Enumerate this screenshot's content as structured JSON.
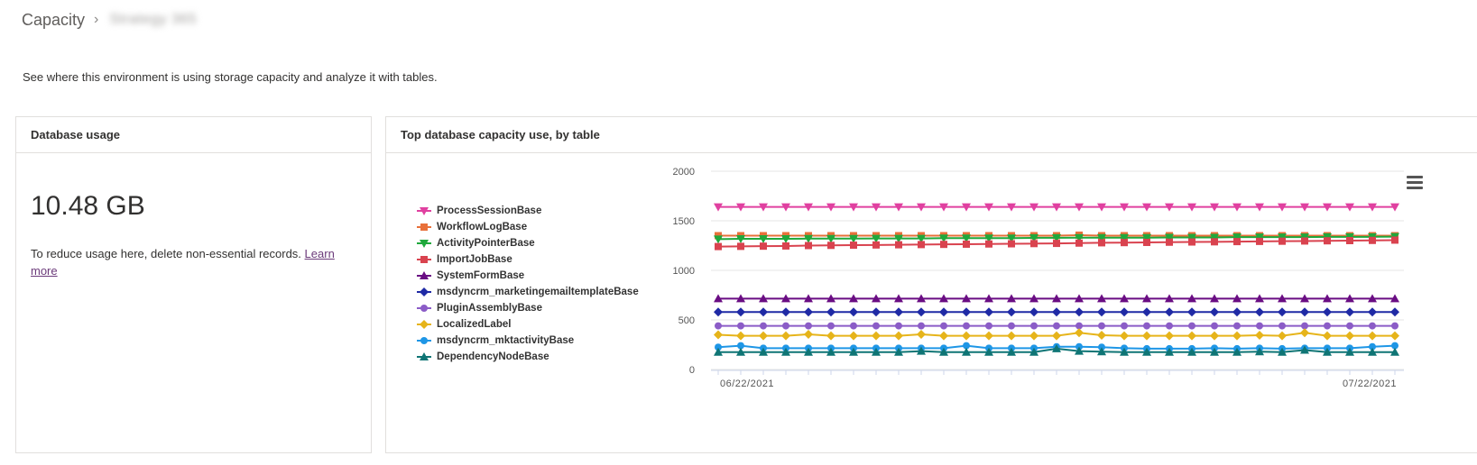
{
  "breadcrumb": {
    "root": "Capacity",
    "current": "Strategy 365"
  },
  "description": "See where this environment is using storage capacity and analyze it with tables.",
  "db_card": {
    "title": "Database usage",
    "value": "10.48 GB",
    "hint": "To reduce usage here, delete non-essential records.",
    "link": "Learn more"
  },
  "chart_card": {
    "title": "Top database capacity use, by table"
  },
  "chart_data": {
    "type": "line",
    "ylim": [
      0,
      2000
    ],
    "yticks": [
      0,
      500,
      1000,
      1500,
      2000
    ],
    "x_start_label": "06/22/2021",
    "x_end_label": "07/22/2021",
    "grid": true,
    "legend_placement": "left",
    "series": [
      {
        "name": "ProcessSessionBase",
        "color": "#e040a0",
        "marker": "triangle-down",
        "values": [
          1640,
          1640,
          1640,
          1640,
          1640,
          1640,
          1640,
          1640,
          1640,
          1640,
          1640,
          1640,
          1640,
          1640,
          1640,
          1640,
          1640,
          1640,
          1640,
          1640,
          1640,
          1640,
          1640,
          1640,
          1640,
          1640,
          1640,
          1640,
          1640,
          1640,
          1640
        ]
      },
      {
        "name": "WorkflowLogBase",
        "color": "#e8703a",
        "marker": "square",
        "values": [
          1350,
          1350,
          1350,
          1350,
          1350,
          1350,
          1350,
          1350,
          1350,
          1350,
          1350,
          1350,
          1350,
          1350,
          1350,
          1350,
          1355,
          1350,
          1350,
          1350,
          1350,
          1350,
          1350,
          1350,
          1350,
          1350,
          1350,
          1350,
          1350,
          1350,
          1350
        ]
      },
      {
        "name": "ActivityPointerBase",
        "color": "#1fa83c",
        "marker": "triangle-down",
        "values": [
          1315,
          1318,
          1318,
          1318,
          1320,
          1320,
          1320,
          1322,
          1322,
          1322,
          1325,
          1325,
          1325,
          1325,
          1328,
          1328,
          1330,
          1330,
          1330,
          1330,
          1332,
          1332,
          1332,
          1335,
          1335,
          1335,
          1335,
          1338,
          1338,
          1338,
          1340
        ]
      },
      {
        "name": "ImportJobBase",
        "color": "#d9434f",
        "marker": "square",
        "values": [
          1240,
          1242,
          1244,
          1246,
          1250,
          1252,
          1254,
          1256,
          1258,
          1260,
          1262,
          1264,
          1266,
          1268,
          1270,
          1272,
          1275,
          1278,
          1280,
          1282,
          1284,
          1286,
          1288,
          1290,
          1292,
          1294,
          1296,
          1298,
          1300,
          1302,
          1305
        ]
      },
      {
        "name": "SystemFormBase",
        "color": "#6a0d83",
        "marker": "triangle-up",
        "values": [
          715,
          715,
          715,
          715,
          715,
          715,
          715,
          715,
          715,
          715,
          715,
          715,
          715,
          715,
          715,
          715,
          715,
          715,
          715,
          715,
          715,
          715,
          715,
          715,
          715,
          715,
          715,
          715,
          715,
          715,
          715
        ]
      },
      {
        "name": "msdyncrm_marketingemailtemplateBase",
        "color": "#1f2aa5",
        "marker": "diamond",
        "values": [
          580,
          580,
          580,
          580,
          580,
          580,
          580,
          580,
          580,
          580,
          580,
          580,
          580,
          580,
          580,
          580,
          580,
          580,
          580,
          580,
          580,
          580,
          580,
          580,
          580,
          580,
          580,
          580,
          580,
          580,
          580
        ]
      },
      {
        "name": "PluginAssemblyBase",
        "color": "#8b5cc7",
        "marker": "circle",
        "values": [
          440,
          440,
          440,
          440,
          440,
          440,
          440,
          440,
          440,
          440,
          440,
          440,
          440,
          440,
          440,
          440,
          440,
          440,
          440,
          440,
          440,
          440,
          440,
          440,
          440,
          440,
          440,
          440,
          440,
          440,
          440
        ]
      },
      {
        "name": "LocalizedLabel",
        "color": "#e6b41a",
        "marker": "diamond",
        "values": [
          350,
          340,
          340,
          340,
          355,
          340,
          340,
          340,
          340,
          355,
          340,
          340,
          340,
          340,
          340,
          340,
          370,
          345,
          340,
          340,
          340,
          340,
          340,
          340,
          345,
          340,
          370,
          340,
          340,
          340,
          340
        ]
      },
      {
        "name": "msdyncrm_mktactivityBase",
        "color": "#1e96e6",
        "marker": "circle",
        "values": [
          225,
          240,
          215,
          215,
          215,
          215,
          215,
          215,
          215,
          215,
          215,
          240,
          215,
          215,
          215,
          230,
          230,
          225,
          215,
          210,
          210,
          210,
          215,
          210,
          215,
          210,
          215,
          215,
          215,
          230,
          240
        ]
      },
      {
        "name": "DependencyNodeBase",
        "color": "#0f7575",
        "marker": "triangle-up",
        "values": [
          175,
          175,
          175,
          175,
          175,
          175,
          175,
          175,
          175,
          185,
          175,
          175,
          175,
          175,
          175,
          210,
          185,
          180,
          175,
          175,
          175,
          175,
          175,
          175,
          180,
          175,
          195,
          175,
          175,
          175,
          175
        ]
      }
    ]
  },
  "icons": {
    "chevron": "chevron-right-icon",
    "menu": "hamburger-menu-icon"
  }
}
